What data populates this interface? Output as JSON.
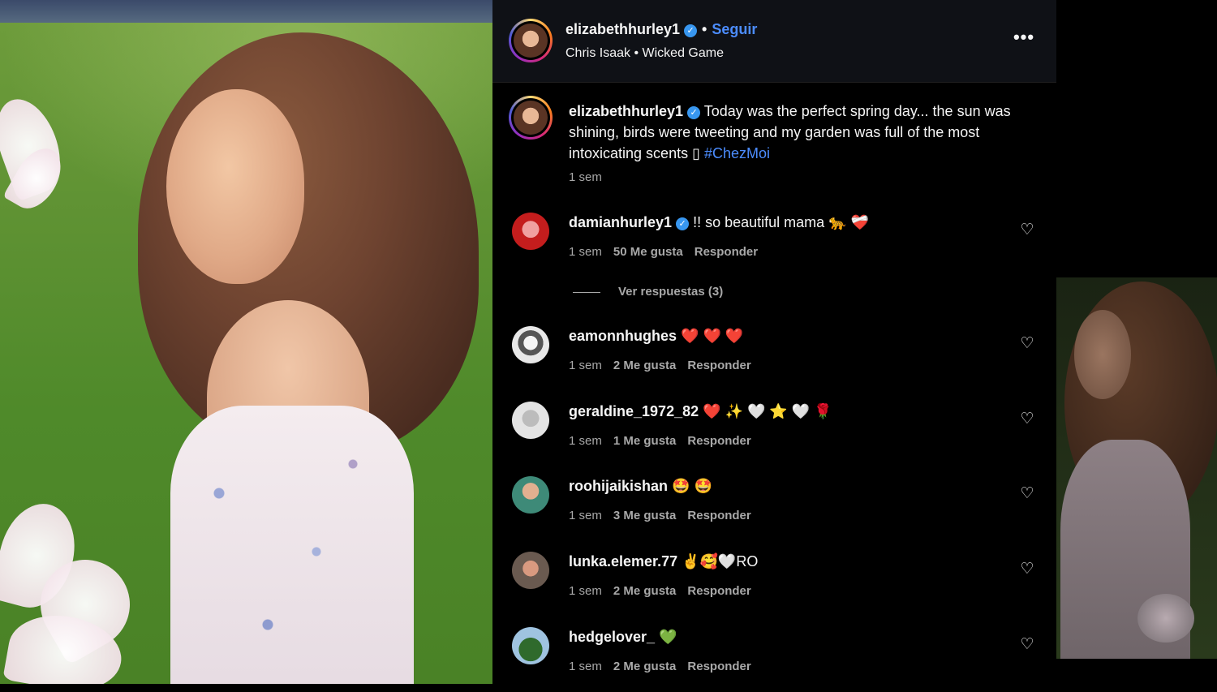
{
  "post": {
    "author": "elizabethhurley1",
    "follow_label": "Seguir",
    "song": "Chris Isaak • Wicked Game",
    "more_label": "•••"
  },
  "caption": {
    "author": "elizabethhurley1",
    "text": "Today was the perfect spring day... the sun was shining, birds were tweeting and my garden was full of the most intoxicating scents",
    "emoji": "▯",
    "hashtag": "#ChezMoi",
    "time": "1 sem"
  },
  "comments": [
    {
      "user": "damianhurley1",
      "verified": true,
      "text": "!! so beautiful mama 🐆 ❤️‍🩹",
      "time": "1 sem",
      "likes": "50 Me gusta",
      "reply": "Responder",
      "avatar_color": "#d32222"
    },
    {
      "user": "eamonnhughes",
      "verified": false,
      "text": "❤️ ❤️ ❤️",
      "time": "1 sem",
      "likes": "2 Me gusta",
      "reply": "Responder",
      "avatar_color": "#cfcfcf"
    },
    {
      "user": "geraldine_1972_82",
      "verified": false,
      "text": "❤️ ✨ 🤍 ⭐ 🤍 🌹",
      "time": "1 sem",
      "likes": "1 Me gusta",
      "reply": "Responder",
      "avatar_color": "#d9d9d9"
    },
    {
      "user": "roohijaikishan",
      "verified": false,
      "text": "🤩 🤩",
      "time": "1 sem",
      "likes": "3 Me gusta",
      "reply": "Responder",
      "avatar_color": "#7a9a6a"
    },
    {
      "user": "lunka.elemer.77",
      "verified": false,
      "text": "✌️🥰🤍RO",
      "time": "1 sem",
      "likes": "2 Me gusta",
      "reply": "Responder",
      "avatar_color": "#b9a89a"
    },
    {
      "user": "hedgelover_",
      "verified": false,
      "text": "💚",
      "time": "1 sem",
      "likes": "2 Me gusta",
      "reply": "Responder",
      "avatar_color": "#3f7a3a"
    }
  ],
  "view_replies": "Ver respuestas (3)",
  "colors": {
    "accent_blue": "#4c8dff",
    "verified_blue": "#3897f0",
    "muted_text": "#a8a8a8"
  }
}
